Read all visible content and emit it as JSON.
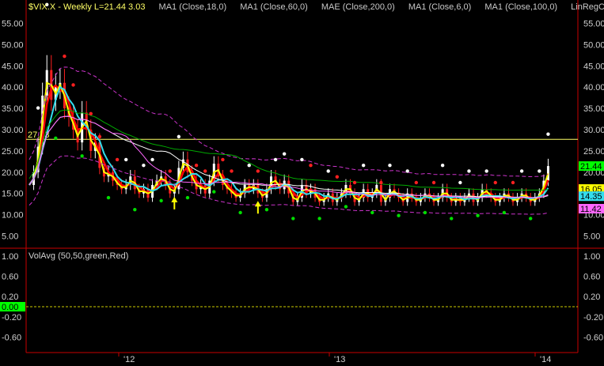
{
  "header": {
    "symbol_info": "$VIX.X - Weekly  L=21.44  3.03",
    "studies": [
      "MA1 (Close,18,0)",
      "MA1 (Close,60,0)",
      "MAE (Close,200,0)",
      "MA1 (Close,6,0)",
      "MA1 (Close,100,0)",
      "LinRegCurv ..."
    ]
  },
  "volume_header": "VolAvg (50,50,green,Red)",
  "colors": {
    "background": "#000000",
    "axis": "#c80000",
    "up_candle": "#ffffff",
    "down_candle": "#ff2020",
    "ma18": "#ff0000",
    "ma60": "#ffffff",
    "ma6": "#ffff00",
    "ma100": "#ff66ff",
    "linreg": "#33ddee",
    "mae": "#cc33cc",
    "green_line": "#00aa00",
    "hline": "#ffff66"
  },
  "chart_data": {
    "type": "candlestick",
    "x_ticks": [
      "'12",
      "'13",
      "'14"
    ],
    "y_price": {
      "min": 2.5,
      "max": 57.5,
      "ticks": [
        "55.00",
        "50.00",
        "45.00",
        "40.00",
        "35.00",
        "30.00",
        "25.00",
        "20.00",
        "15.00",
        "10.00",
        "5.00"
      ]
    },
    "y_volume": {
      "ticks_right": [
        "1.00",
        "0.60",
        "0.20",
        "-0.20",
        "-0.60"
      ],
      "ticks_left": [
        "1.00",
        "0.60",
        "0.20",
        "0.00",
        "-0.20",
        "-0.60"
      ]
    },
    "horizontal_level": "27.73",
    "tags": [
      {
        "text": "21.44",
        "value": 21.44,
        "color": "#00ff00"
      },
      {
        "text": "16.05",
        "value": 16.05,
        "color": "#ffff00"
      },
      {
        "text": "14.35",
        "value": 14.35,
        "color": "#33ddee"
      },
      {
        "text": "11.42",
        "value": 11.42,
        "color": "#ff66ff"
      }
    ],
    "volume_zero_label": "0.00",
    "close_series": [
      17,
      20,
      26,
      38,
      44,
      37,
      40,
      41,
      35,
      33,
      30,
      27,
      34,
      30,
      25,
      27,
      21,
      19,
      20,
      18,
      17,
      16,
      17,
      19,
      16,
      15,
      16,
      14,
      17,
      18,
      19,
      17,
      15,
      16,
      21,
      23,
      20,
      18,
      16,
      17,
      15,
      18,
      22,
      19,
      17,
      16,
      15,
      14,
      15,
      17,
      16,
      17,
      15,
      14,
      16,
      19,
      17,
      16,
      18,
      15,
      13,
      14,
      17,
      15,
      16,
      14,
      13,
      14,
      15,
      13,
      14,
      15,
      17,
      15,
      13,
      14,
      16,
      14,
      15,
      17,
      13,
      14,
      16,
      15,
      14,
      13,
      15,
      14,
      13,
      14,
      15,
      14,
      13,
      14,
      16,
      14,
      13,
      14,
      13,
      14,
      15,
      13,
      14,
      16,
      15,
      14,
      13,
      14,
      15,
      14,
      13,
      14,
      15,
      14,
      13,
      14,
      15,
      18,
      21.44
    ]
  }
}
